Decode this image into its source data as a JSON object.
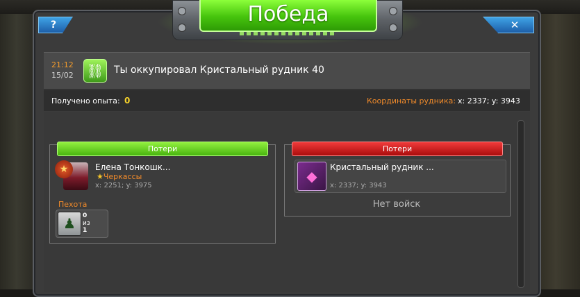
{
  "window": {
    "title": "Победа",
    "help_label": "?",
    "close_label": "✕"
  },
  "event": {
    "time": "21:12",
    "date": "15/02",
    "icon": "chain-link-icon",
    "text": "Ты оккупировал Кристальный рудник 40"
  },
  "info": {
    "exp_label": "Получено опыта:",
    "exp_value": "0",
    "coord_label": "Координаты рудника:",
    "coord_value": "x: 2337; y: 3943"
  },
  "attacker": {
    "header": "Потери",
    "header_color": "#5cc31c",
    "name": "Елена Тонкошк...",
    "city": "Черкассы",
    "coords": "x: 2251; y: 3975",
    "section": "Пехота",
    "troops": {
      "lost": "0",
      "of_label": "из",
      "total": "1"
    }
  },
  "defender": {
    "header": "Потери",
    "header_color": "#c51a1a",
    "name": "Кристальный рудник ...",
    "coords": "x: 2337; y: 3943",
    "empty_text": "Нет войск"
  },
  "colors": {
    "accent_orange": "#f28b2a",
    "exp_yellow": "#f5d22a",
    "title_green": "#46c40d"
  }
}
